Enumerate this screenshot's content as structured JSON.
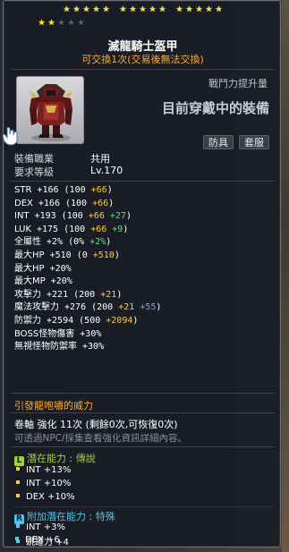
{
  "stars": {
    "row1_filled": 15,
    "row2_filled": 2,
    "row2_total": 5
  },
  "item": {
    "name": "滅龍騎士盔甲",
    "tradable": "可交換1次(交易後無法交換)",
    "power_label": "戰鬥力提升量",
    "power_value": "目前穿戴中的裝備",
    "tags": [
      "防具",
      "套服"
    ]
  },
  "requirements": [
    {
      "label": "裝備職業",
      "value": "共用"
    },
    {
      "label": "要求等級",
      "value": "Lv.170"
    }
  ],
  "stats": [
    {
      "label": "STR",
      "total": "+166",
      "base": "(100",
      "parts": [
        {
          "t": " +66",
          "c": "yellow"
        }
      ],
      "close": ")"
    },
    {
      "label": "DEX",
      "total": "+166",
      "base": "(100",
      "parts": [
        {
          "t": " +66",
          "c": "yellow"
        }
      ],
      "close": ")"
    },
    {
      "label": "INT",
      "total": "+193",
      "base": "(100",
      "parts": [
        {
          "t": " +66",
          "c": "yellow"
        },
        {
          "t": " +27",
          "c": "green"
        }
      ],
      "close": ")"
    },
    {
      "label": "LUK",
      "total": "+175",
      "base": "(100",
      "parts": [
        {
          "t": " +66",
          "c": "yellow"
        },
        {
          "t": " +9",
          "c": "green"
        }
      ],
      "close": ")"
    },
    {
      "label": "全屬性",
      "total": "+2%",
      "base": "(0%",
      "parts": [
        {
          "t": " +2%",
          "c": "green"
        }
      ],
      "close": ")"
    },
    {
      "label": "最大HP",
      "total": "+510",
      "base": "(0",
      "parts": [
        {
          "t": " +510",
          "c": "yellow"
        }
      ],
      "close": ")"
    },
    {
      "label": "最大HP",
      "total": "+20%",
      "base": "",
      "parts": [],
      "close": ""
    },
    {
      "label": "最大MP",
      "total": "+20%",
      "base": "",
      "parts": [],
      "close": ""
    },
    {
      "label": "攻擊力",
      "total": "+221",
      "base": "(200",
      "parts": [
        {
          "t": " +21",
          "c": "yellow"
        }
      ],
      "close": ")"
    },
    {
      "label": "魔法攻擊力",
      "total": "+276",
      "base": "(200",
      "parts": [
        {
          "t": " +21",
          "c": "yellow"
        },
        {
          "t": " +55",
          "c": "purple"
        }
      ],
      "close": ")"
    },
    {
      "label": "防禦力",
      "total": "+2594",
      "base": "(500",
      "parts": [
        {
          "t": " +2094",
          "c": "yellow"
        }
      ],
      "close": ")"
    },
    {
      "label": "BOSS怪物傷害",
      "total": "+30%",
      "base": "",
      "parts": [],
      "close": ""
    },
    {
      "label": "無視怪物防禦率",
      "total": "+30%",
      "base": "",
      "parts": [],
      "close": ""
    }
  ],
  "soul": "引發龍咆嘯的威力",
  "scroll": "卷軸 強化 11次 (剩餘0次,可恢復0次)",
  "hint": "可透過NPC/採集查看強化資訊詳細內容。",
  "potential": {
    "badge": "L",
    "title": "潛在能力 : ",
    "grade": "傳說",
    "lines": [
      "INT +13%",
      "INT +10%",
      "DEX +10%"
    ]
  },
  "bonus_potential": {
    "badge": "R",
    "title": "附加潛在能力 : ",
    "grade": "特殊",
    "lines": [
      "INT +3%",
      "跳躍力 +4",
      "DEX +6"
    ]
  },
  "colors": {
    "legendary": "#9ed13c",
    "rare": "#4ec3e8",
    "tradable": "#ffaa33",
    "star": "#ffdd33"
  }
}
